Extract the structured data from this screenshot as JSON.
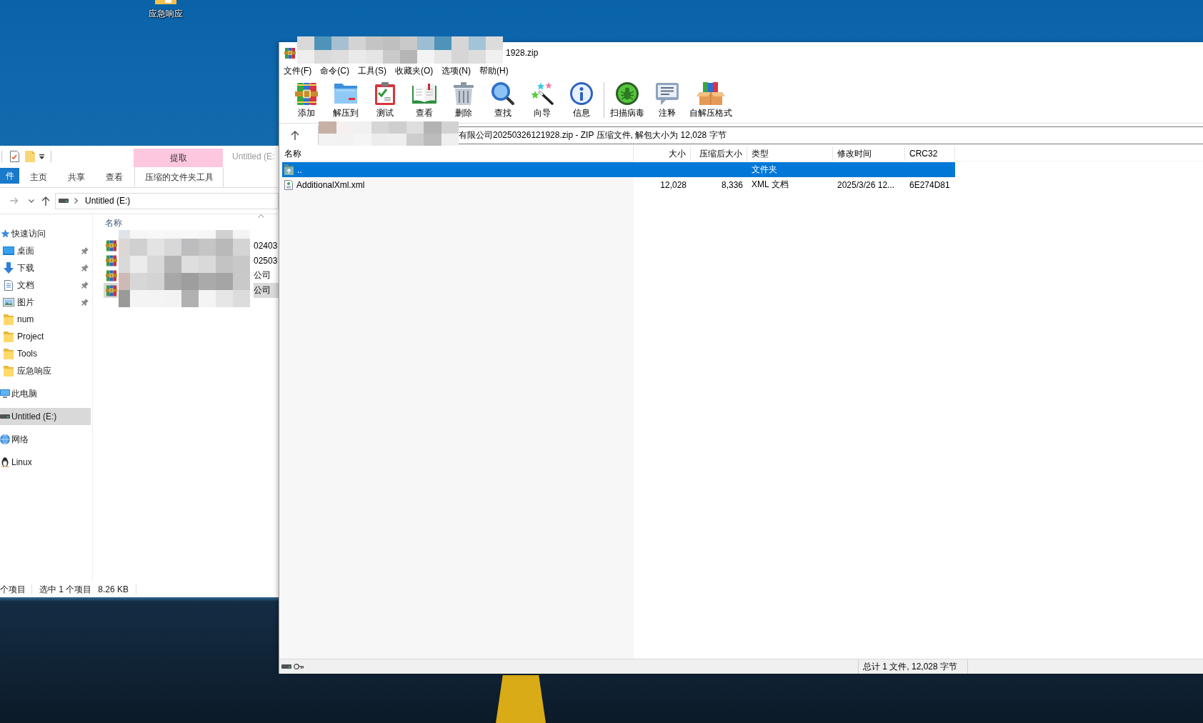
{
  "desktop": {
    "icons": [
      {
        "label": "应急响应"
      }
    ]
  },
  "explorer": {
    "tab_group": "提取",
    "title": "Untitled (E:",
    "ribbon_tabs": [
      {
        "label": "件",
        "kind": "file"
      },
      {
        "label": "主页",
        "kind": "tab"
      },
      {
        "label": "共享",
        "kind": "tab"
      },
      {
        "label": "查看",
        "kind": "tab"
      },
      {
        "label": "压缩的文件夹工具",
        "kind": "contextual"
      }
    ],
    "address": {
      "path": "Untitled (E:)"
    },
    "navigation": [
      {
        "label": "快速访问",
        "kind": "quick-access",
        "selected": false,
        "children": [
          {
            "label": "桌面",
            "kind": "desktop",
            "selected": false,
            "pinned": true
          },
          {
            "label": "下载",
            "kind": "downloads",
            "selected": false,
            "pinned": true
          },
          {
            "label": "文档",
            "kind": "documents",
            "selected": false,
            "pinned": true
          },
          {
            "label": "图片",
            "kind": "pictures",
            "selected": false,
            "pinned": true
          },
          {
            "label": "num",
            "kind": "folder",
            "selected": false,
            "pinned": false
          },
          {
            "label": "Project",
            "kind": "folder",
            "selected": false,
            "pinned": false
          },
          {
            "label": "Tools",
            "kind": "folder",
            "selected": false,
            "pinned": false
          },
          {
            "label": "应急响应",
            "kind": "folder",
            "selected": false,
            "pinned": false
          }
        ]
      },
      {
        "label": "此电脑",
        "kind": "pc",
        "selected": false
      },
      {
        "label": "Untitled (E:)",
        "kind": "drive",
        "selected": true
      },
      {
        "label": "网络",
        "kind": "network",
        "selected": false
      },
      {
        "label": "Linux",
        "kind": "linux",
        "selected": false
      }
    ],
    "files": {
      "column": "名称",
      "rows": [
        {
          "name": "02403",
          "selected": false
        },
        {
          "name": "02503",
          "selected": false
        },
        {
          "name": "公司",
          "selected": false
        },
        {
          "name": "公司",
          "selected": true
        }
      ]
    },
    "status_bar": [
      "个项目",
      "选中 1 个项目",
      "8.26 KB"
    ]
  },
  "winrar": {
    "title": "1928.zip",
    "menu": [
      "文件(F)",
      "命令(C)",
      "工具(S)",
      "收藏夹(O)",
      "选项(N)",
      "帮助(H)"
    ],
    "toolbar_groups": [
      {
        "buttons": [
          {
            "label": "添加",
            "kind": "add"
          },
          {
            "label": "解压到",
            "kind": "extract"
          },
          {
            "label": "测试",
            "kind": "test"
          },
          {
            "label": "查看",
            "kind": "view"
          },
          {
            "label": "删除",
            "kind": "delete"
          },
          {
            "label": "查找",
            "kind": "find"
          },
          {
            "label": "向导",
            "kind": "wizard"
          },
          {
            "label": "信息",
            "kind": "info"
          }
        ]
      },
      {
        "buttons": [
          {
            "label": "扫描病毒",
            "kind": "scan"
          },
          {
            "label": "注释",
            "kind": "comment"
          },
          {
            "label": "自解压格式",
            "kind": "sfx"
          }
        ]
      }
    ],
    "path": "有限公司20250326121928.zip - ZIP 压缩文件, 解包大小为 12,028 字节",
    "columns": [
      "名称",
      "大小",
      "压缩后大小",
      "类型",
      "修改时间",
      "CRC32"
    ],
    "rows": [
      {
        "kind": "parent-folder",
        "name": "..",
        "type": "文件夹",
        "selected": true
      },
      {
        "kind": "xml",
        "name": "AdditionalXml.xml",
        "size": "12,028",
        "packed": "8,336",
        "type": "XML 文档",
        "modified": "2025/3/26 12...",
        "crc": "6E274D81",
        "selected": false
      }
    ],
    "status_bar": "总计 1 文件, 12,028 字节"
  }
}
